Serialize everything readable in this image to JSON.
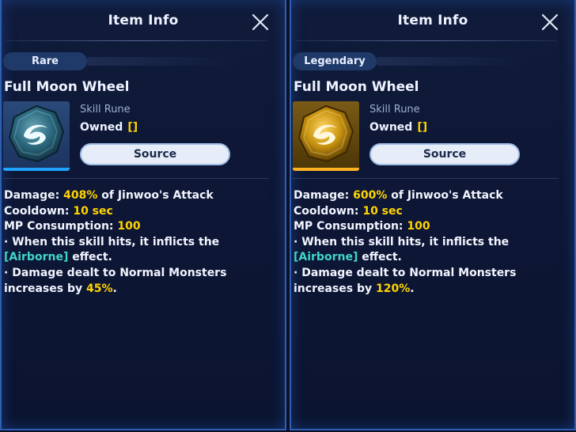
{
  "panels": [
    {
      "title": "Item Info",
      "grade": "Rare",
      "item_name": "Full Moon Wheel",
      "item_type": "Skill Rune",
      "owned_label": "Owned",
      "owned_value": "[]",
      "source_label": "Source",
      "desc": {
        "damage_label": "Damage: ",
        "damage_value": "408%",
        "damage_suffix": " of Jinwoo's Attack",
        "cooldown_label": "Cooldown: ",
        "cooldown_value": "10 sec",
        "mp_label": "MP Consumption: ",
        "mp_value": "100",
        "effect_line1": " · When this skill hits, it inflicts the",
        "effect_tag": "[Airborne]",
        "effect_line2_suffix": " effect.",
        "bonus_line1": " · Damage dealt to Normal Monsters",
        "bonus_prefix": "increases by ",
        "bonus_value": "45%",
        "bonus_suffix": "."
      },
      "icon": "rune-gem-icon",
      "accent_color": "#1fa3ff"
    },
    {
      "title": "Item Info",
      "grade": "Legendary",
      "item_name": "Full Moon Wheel",
      "item_type": "Skill Rune",
      "owned_label": "Owned",
      "owned_value": "[]",
      "source_label": "Source",
      "desc": {
        "damage_label": "Damage: ",
        "damage_value": "600%",
        "damage_suffix": " of Jinwoo's Attack",
        "cooldown_label": "Cooldown: ",
        "cooldown_value": "10 sec",
        "mp_label": "MP Consumption: ",
        "mp_value": "100",
        "effect_line1": " · When this skill hits, it inflicts the",
        "effect_tag": "[Airborne]",
        "effect_line2_suffix": " effect.",
        "bonus_line1": " · Damage dealt to Normal Monsters",
        "bonus_prefix": "increases by ",
        "bonus_value": "120%",
        "bonus_suffix": "."
      },
      "icon": "rune-gem-icon",
      "accent_color": "#ffb21f"
    }
  ],
  "colors": {
    "highlight": "#ffd400",
    "status_tag": "#3fd6c8",
    "panel_border": "#2f5fb0"
  }
}
